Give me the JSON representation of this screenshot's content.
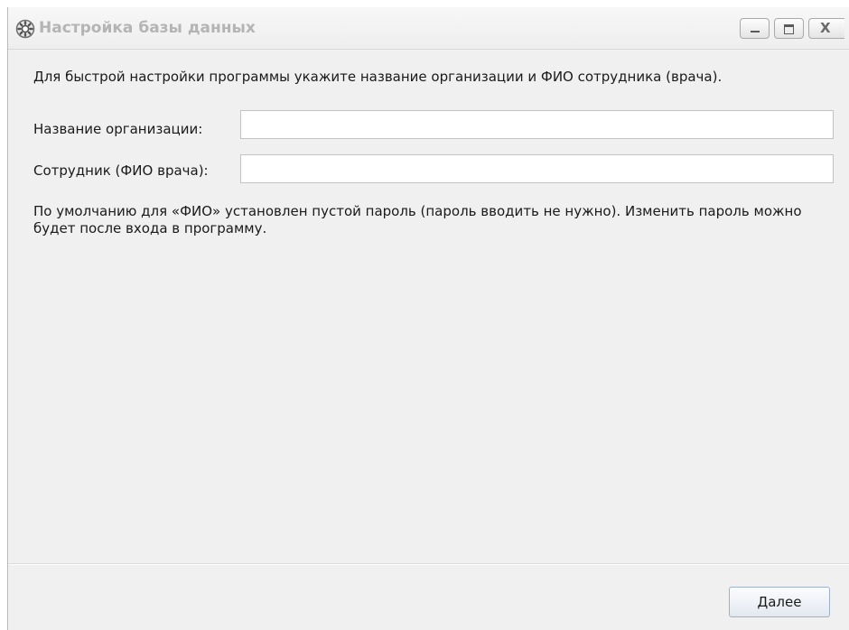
{
  "window": {
    "title": "Настройка базы данных",
    "icon": "gear-icon",
    "controls": {
      "minimize": "minimize-icon",
      "maximize": "maximize-icon",
      "close": "X"
    }
  },
  "form": {
    "intro": "Для быстрой настройки программы укажите название организации и ФИО сотрудника (врача).",
    "organization_label": "Название организации:",
    "organization_value": "",
    "employee_label": "Сотрудник (ФИО врача):",
    "employee_value": "",
    "note": "По умолчанию для «ФИО» установлен пустой пароль (пароль вводить не нужно). Изменить пароль можно будет после входа в программу."
  },
  "footer": {
    "next_label": "Далее"
  },
  "colors": {
    "window_bg": "#f0f0f0",
    "title_text": "#b4b4b4",
    "input_border": "#c3c3c3",
    "button_border": "#9fb0c9"
  }
}
